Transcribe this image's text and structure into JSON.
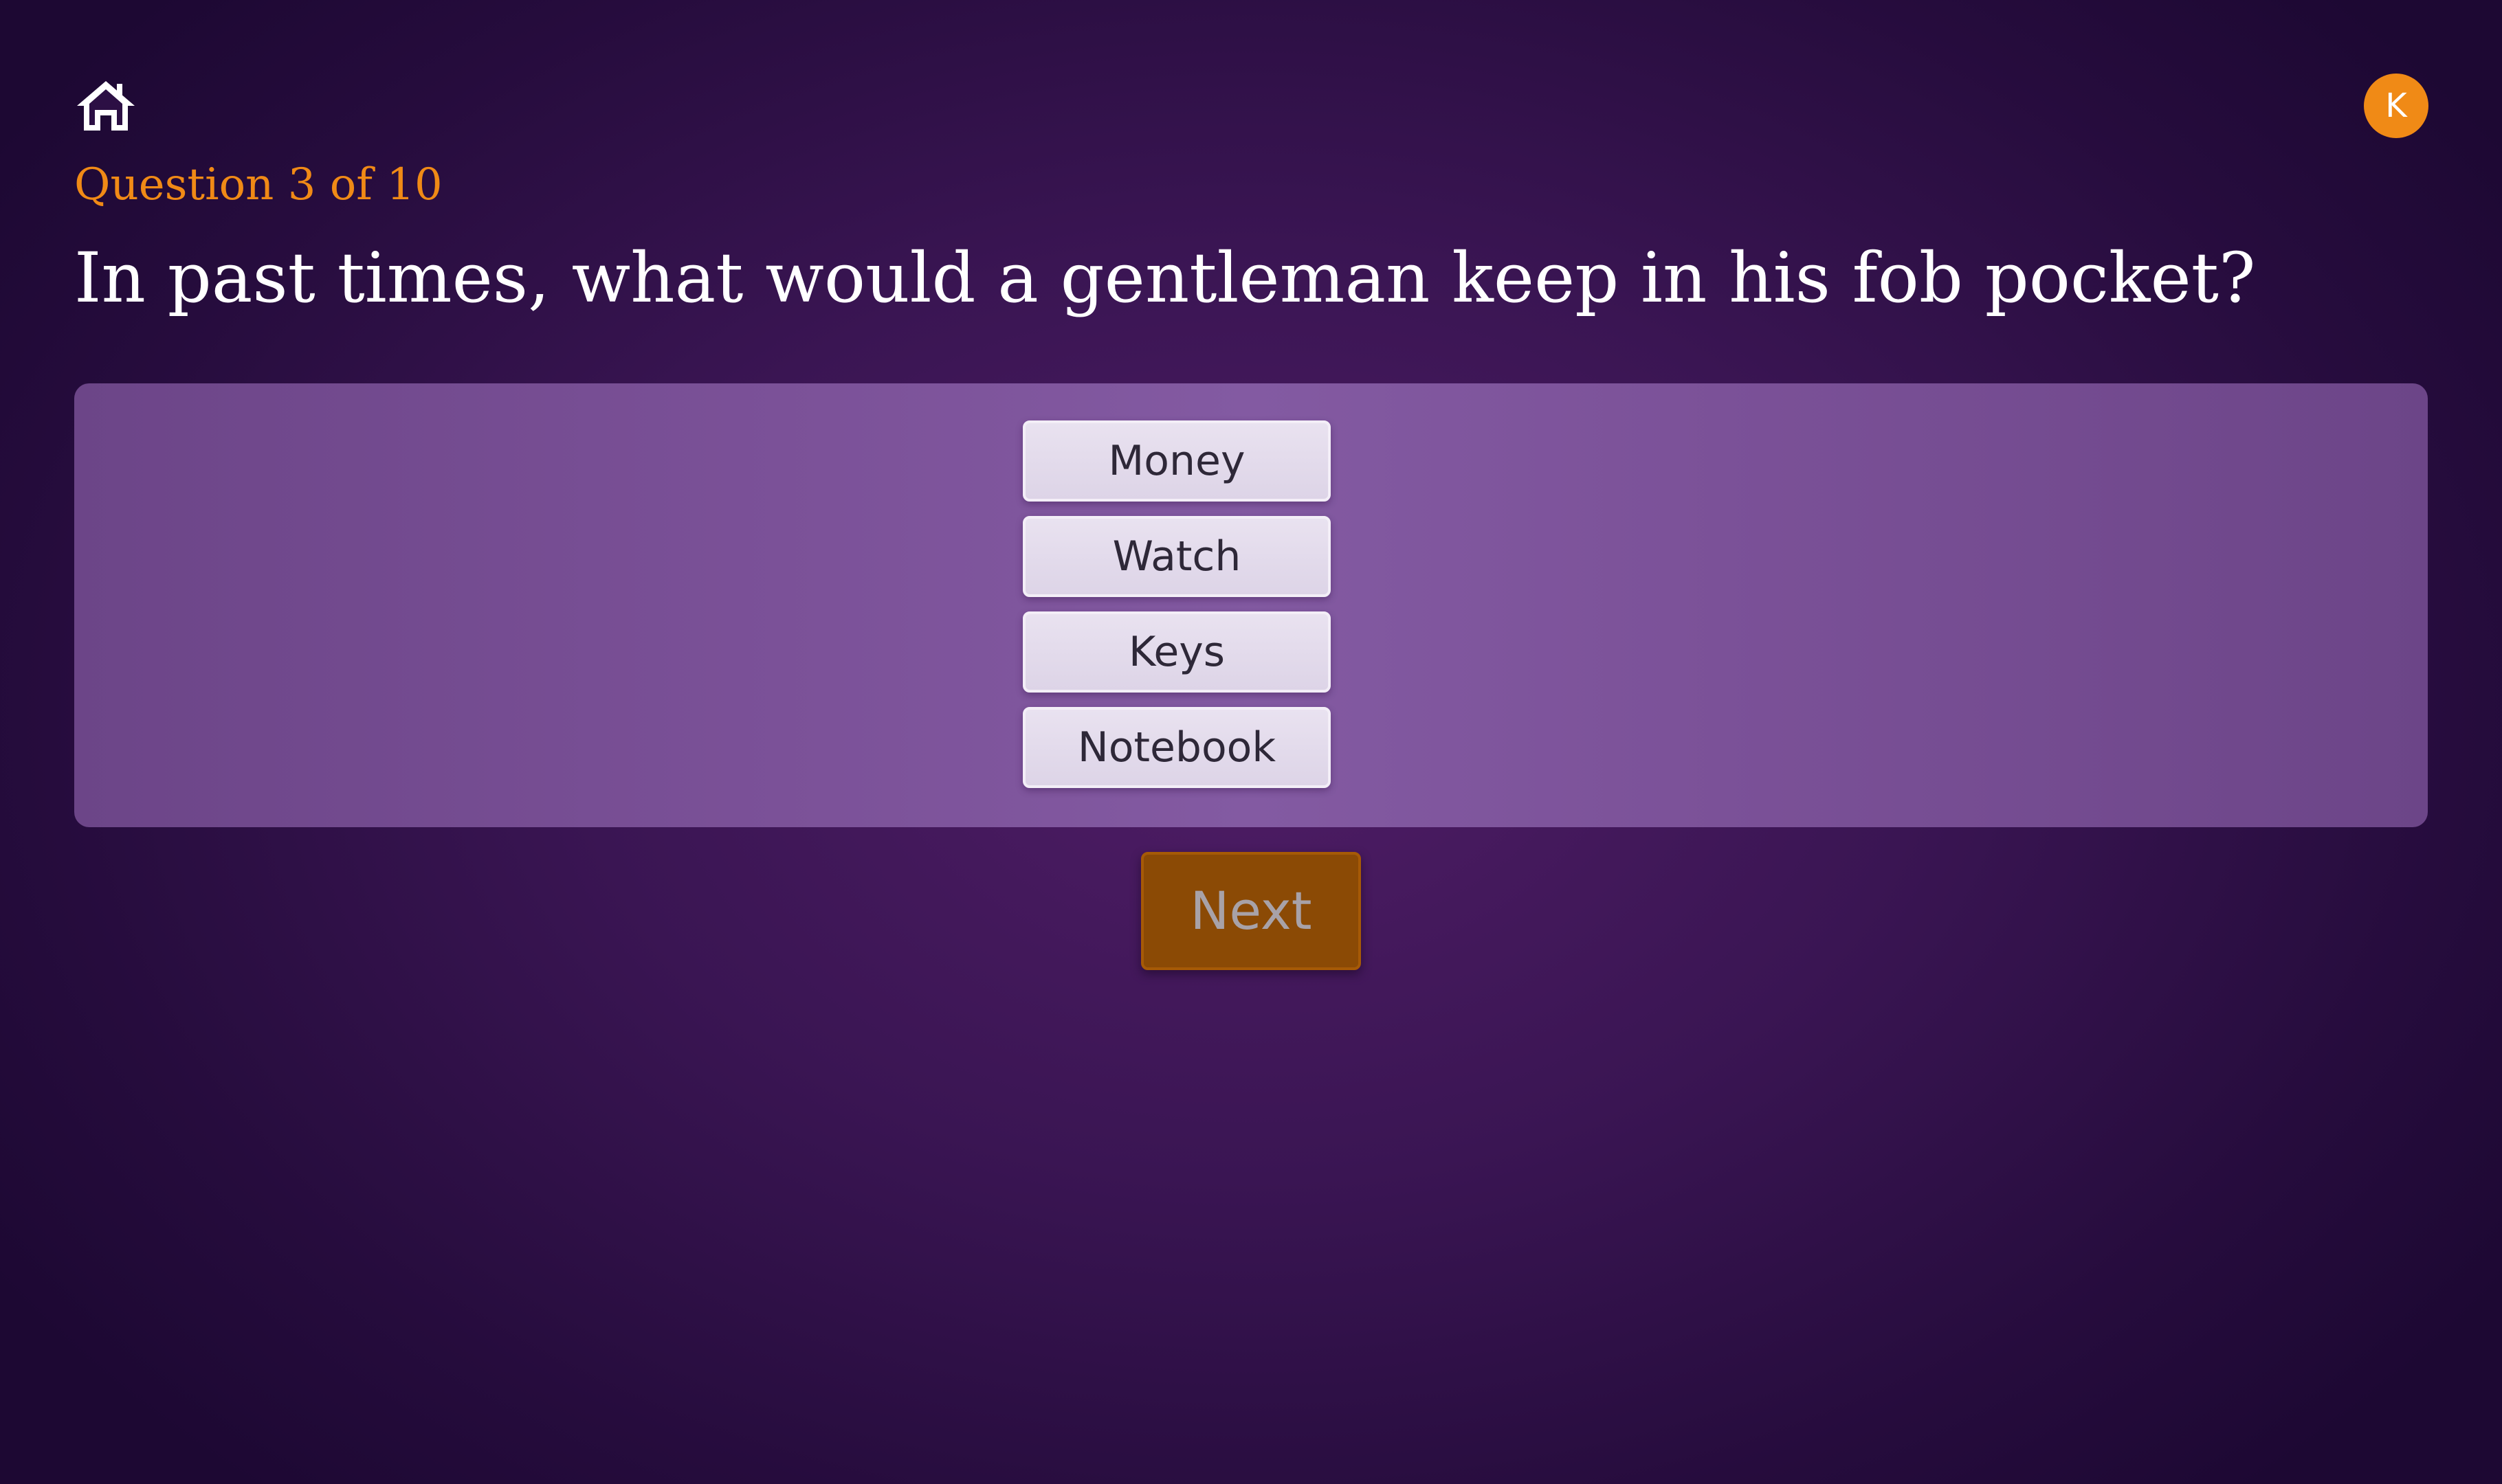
{
  "header": {
    "home_icon": "home-icon",
    "avatar_initial": "K",
    "avatar_color": "#f08a16"
  },
  "quiz": {
    "progress_text": "Question 3 of 10",
    "question_text": "In past times, what would a gentleman keep in his fob pocket?",
    "answers": [
      {
        "label": "Money"
      },
      {
        "label": "Watch"
      },
      {
        "label": "Keys"
      },
      {
        "label": "Notebook"
      }
    ],
    "next_label": "Next"
  },
  "colors": {
    "accent": "#f08a16",
    "background": "#3a1553",
    "panel": "#7b5198",
    "answer_button": "#e3dbeb",
    "next_button": "#8b4a05"
  }
}
